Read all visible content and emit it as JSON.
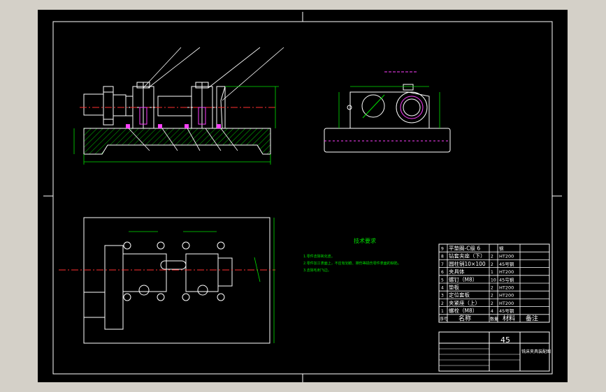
{
  "technical_requirements": {
    "title": "技术要求",
    "items": [
      "1.零件去除氧化皮。",
      "2.零件加工表面上，不应有划痕、擦伤等损伤零件表面的缺陷。",
      "3.去除毛刺飞边。"
    ]
  },
  "bom": {
    "headers": {
      "no": "序号",
      "name": "名称",
      "qty": "数量",
      "material": "材料",
      "remark": "备注"
    },
    "rows": [
      {
        "no": "9",
        "name": "平垫圈-C级 6",
        "qty": "",
        "material": "钢"
      },
      {
        "no": "8",
        "name": "钻套夹座（下）",
        "qty": "2",
        "material": "HT200"
      },
      {
        "no": "7",
        "name": "圆柱销10×100",
        "qty": "2",
        "material": "45号钢"
      },
      {
        "no": "6",
        "name": "夹具体",
        "qty": "1",
        "material": "HT200"
      },
      {
        "no": "5",
        "name": "螺钉（M8）",
        "qty": "10",
        "material": "45号钢"
      },
      {
        "no": "4",
        "name": "垫板",
        "qty": "2",
        "material": "HT200"
      },
      {
        "no": "3",
        "name": "定位套板",
        "qty": "2",
        "material": "HT200"
      },
      {
        "no": "2",
        "name": "夹紧座（上）",
        "qty": "2",
        "material": "HT200"
      },
      {
        "no": "1",
        "name": "螺栓（M8）",
        "qty": "4",
        "material": "45号钢"
      }
    ]
  },
  "title_block": {
    "material": "45",
    "drawing_title": "铣床夹具装配图"
  },
  "colors": {
    "background": "#000000",
    "frame": "#ffffff",
    "outline": "#ffffff",
    "dimension": "#00e000",
    "centerline": "#ff3030",
    "hatch": "#00e000",
    "leader": "#ffffff",
    "bolt": "#ff40ff",
    "title_green": "#00e000"
  }
}
